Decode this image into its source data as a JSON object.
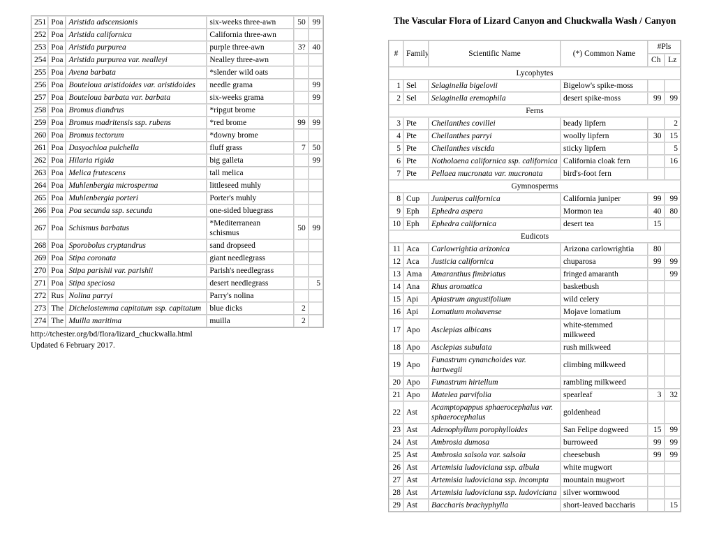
{
  "document": {
    "title": "The Vascular Flora of Lizard Canyon and Chuckwalla Wash / Canyon",
    "source_url": "http://tchester.org/bd/flora/lizard_chuckwalla.html",
    "updated": "Updated 6 February 2017."
  },
  "table_header": {
    "num": "#",
    "family": "Family",
    "scientific_name": "Scientific Name",
    "common_name": "(*) Common Name",
    "plants_group": "#Pls",
    "ch": "Ch",
    "lz": "Lz"
  },
  "left_table": {
    "rows": [
      {
        "num": "251",
        "family": "Poa",
        "sci": "Aristida adscensionis",
        "com": "six-weeks three-awn",
        "ch": "50",
        "lz": "99"
      },
      {
        "num": "252",
        "family": "Poa",
        "sci": "Aristida californica",
        "com": "California three-awn",
        "ch": "",
        "lz": ""
      },
      {
        "num": "253",
        "family": "Poa",
        "sci": "Aristida purpurea",
        "com": "purple three-awn",
        "ch": "3?",
        "lz": "40"
      },
      {
        "num": "254",
        "family": "Poa",
        "sci": "Aristida purpurea var. nealleyi",
        "com": "Nealley three-awn",
        "ch": "",
        "lz": ""
      },
      {
        "num": "255",
        "family": "Poa",
        "sci": "Avena barbata",
        "com": "*slender wild oats",
        "ch": "",
        "lz": ""
      },
      {
        "num": "256",
        "family": "Poa",
        "sci": "Bouteloua aristidoides var. aristidoides",
        "com": "needle grama",
        "ch": "",
        "lz": "99"
      },
      {
        "num": "257",
        "family": "Poa",
        "sci": "Bouteloua barbata var. barbata",
        "com": "six-weeks grama",
        "ch": "",
        "lz": "99"
      },
      {
        "num": "258",
        "family": "Poa",
        "sci": "Bromus diandrus",
        "com": "*ripgut brome",
        "ch": "",
        "lz": ""
      },
      {
        "num": "259",
        "family": "Poa",
        "sci": "Bromus madritensis ssp. rubens",
        "com": "*red brome",
        "ch": "99",
        "lz": "99"
      },
      {
        "num": "260",
        "family": "Poa",
        "sci": "Bromus tectorum",
        "com": "*downy brome",
        "ch": "",
        "lz": ""
      },
      {
        "num": "261",
        "family": "Poa",
        "sci": "Dasyochloa pulchella",
        "com": "fluff grass",
        "ch": "7",
        "lz": "50"
      },
      {
        "num": "262",
        "family": "Poa",
        "sci": "Hilaria rigida",
        "com": "big galleta",
        "ch": "",
        "lz": "99"
      },
      {
        "num": "263",
        "family": "Poa",
        "sci": "Melica frutescens",
        "com": "tall melica",
        "ch": "",
        "lz": ""
      },
      {
        "num": "264",
        "family": "Poa",
        "sci": "Muhlenbergia microsperma",
        "com": "littleseed muhly",
        "ch": "",
        "lz": ""
      },
      {
        "num": "265",
        "family": "Poa",
        "sci": "Muhlenbergia porteri",
        "com": "Porter's muhly",
        "ch": "",
        "lz": ""
      },
      {
        "num": "266",
        "family": "Poa",
        "sci": "Poa secunda ssp. secunda",
        "com": "one-sided bluegrass",
        "ch": "",
        "lz": ""
      },
      {
        "num": "267",
        "family": "Poa",
        "sci": "Schismus barbatus",
        "com": "*Mediterranean schismus",
        "ch": "50",
        "lz": "99"
      },
      {
        "num": "268",
        "family": "Poa",
        "sci": "Sporobolus cryptandrus",
        "com": "sand dropseed",
        "ch": "",
        "lz": ""
      },
      {
        "num": "269",
        "family": "Poa",
        "sci": "Stipa coronata",
        "com": "giant needlegrass",
        "ch": "",
        "lz": ""
      },
      {
        "num": "270",
        "family": "Poa",
        "sci": "Stipa parishii var. parishii",
        "com": "Parish's needlegrass",
        "ch": "",
        "lz": ""
      },
      {
        "num": "271",
        "family": "Poa",
        "sci": "Stipa speciosa",
        "com": "desert needlegrass",
        "ch": "",
        "lz": "5"
      },
      {
        "num": "272",
        "family": "Rus",
        "sci": "Nolina parryi",
        "com": "Parry's nolina",
        "ch": "",
        "lz": ""
      },
      {
        "num": "273",
        "family": "The",
        "sci": "Dichelostemma capitatum ssp. capitatum",
        "com": "blue dicks",
        "ch": "2",
        "lz": ""
      },
      {
        "num": "274",
        "family": "The",
        "sci": "Muilla maritima",
        "com": "muilla",
        "ch": "2",
        "lz": ""
      }
    ]
  },
  "right_table": {
    "blocks": [
      {
        "group": "Lycophytes",
        "rows": [
          {
            "num": "1",
            "family": "Sel",
            "sci": "Selaginella bigelovii",
            "com": "Bigelow's spike-moss",
            "ch": "",
            "lz": ""
          },
          {
            "num": "2",
            "family": "Sel",
            "sci": "Selaginella eremophila",
            "com": "desert spike-moss",
            "ch": "99",
            "lz": "99"
          }
        ]
      },
      {
        "group": "Ferns",
        "rows": [
          {
            "num": "3",
            "family": "Pte",
            "sci": "Cheilanthes covillei",
            "com": "beady lipfern",
            "ch": "",
            "lz": "2"
          },
          {
            "num": "4",
            "family": "Pte",
            "sci": "Cheilanthes parryi",
            "com": "woolly lipfern",
            "ch": "30",
            "lz": "15"
          },
          {
            "num": "5",
            "family": "Pte",
            "sci": "Cheilanthes viscida",
            "com": "sticky lipfern",
            "ch": "",
            "lz": "5"
          },
          {
            "num": "6",
            "family": "Pte",
            "sci": "Notholaena californica ssp. californica",
            "com": "California cloak fern",
            "ch": "",
            "lz": "16"
          },
          {
            "num": "7",
            "family": "Pte",
            "sci": "Pellaea mucronata var. mucronata",
            "com": "bird's-foot fern",
            "ch": "",
            "lz": ""
          }
        ]
      },
      {
        "group": "Gymnosperms",
        "rows": [
          {
            "num": "8",
            "family": "Cup",
            "sci": "Juniperus californica",
            "com": "California juniper",
            "ch": "99",
            "lz": "99"
          },
          {
            "num": "9",
            "family": "Eph",
            "sci": "Ephedra aspera",
            "com": "Mormon tea",
            "ch": "40",
            "lz": "80"
          },
          {
            "num": "10",
            "family": "Eph",
            "sci": "Ephedra californica",
            "com": "desert tea",
            "ch": "15",
            "lz": ""
          }
        ]
      },
      {
        "group": "Eudicots",
        "rows": [
          {
            "num": "11",
            "family": "Aca",
            "sci": "Carlowrightia arizonica",
            "com": "Arizona carlowrightia",
            "ch": "80",
            "lz": ""
          },
          {
            "num": "12",
            "family": "Aca",
            "sci": "Justicia californica",
            "com": "chuparosa",
            "ch": "99",
            "lz": "99"
          },
          {
            "num": "13",
            "family": "Ama",
            "sci": "Amaranthus fimbriatus",
            "com": "fringed amaranth",
            "ch": "",
            "lz": "99"
          },
          {
            "num": "14",
            "family": "Ana",
            "sci": "Rhus aromatica",
            "com": "basketbush",
            "ch": "",
            "lz": ""
          },
          {
            "num": "15",
            "family": "Api",
            "sci": "Apiastrum angustifolium",
            "com": "wild celery",
            "ch": "",
            "lz": ""
          },
          {
            "num": "16",
            "family": "Api",
            "sci": "Lomatium mohavense",
            "com": "Mojave lomatium",
            "ch": "",
            "lz": ""
          },
          {
            "num": "17",
            "family": "Apo",
            "sci": "Asclepias albicans",
            "com": "white-stemmed milkweed",
            "ch": "",
            "lz": ""
          },
          {
            "num": "18",
            "family": "Apo",
            "sci": "Asclepias subulata",
            "com": "rush milkweed",
            "ch": "",
            "lz": ""
          },
          {
            "num": "19",
            "family": "Apo",
            "sci": "Funastrum cynanchoides var. hartwegii",
            "com": "climbing milkweed",
            "ch": "",
            "lz": ""
          },
          {
            "num": "20",
            "family": "Apo",
            "sci": "Funastrum hirtellum",
            "com": "rambling milkweed",
            "ch": "",
            "lz": ""
          },
          {
            "num": "21",
            "family": "Apo",
            "sci": "Matelea parvifolia",
            "com": "spearleaf",
            "ch": "3",
            "lz": "32"
          },
          {
            "num": "22",
            "family": "Ast",
            "sci": "Acamptopappus sphaerocephalus var. sphaerocephalus",
            "com": "goldenhead",
            "ch": "",
            "lz": "",
            "tall": true
          },
          {
            "num": "23",
            "family": "Ast",
            "sci": "Adenophyllum porophylloides",
            "com": "San Felipe dogweed",
            "ch": "15",
            "lz": "99"
          },
          {
            "num": "24",
            "family": "Ast",
            "sci": "Ambrosia dumosa",
            "com": "burroweed",
            "ch": "99",
            "lz": "99"
          },
          {
            "num": "25",
            "family": "Ast",
            "sci": "Ambrosia salsola var. salsola",
            "com": "cheesebush",
            "ch": "99",
            "lz": "99"
          },
          {
            "num": "26",
            "family": "Ast",
            "sci": "Artemisia ludoviciana ssp. albula",
            "com": "white mugwort",
            "ch": "",
            "lz": ""
          },
          {
            "num": "27",
            "family": "Ast",
            "sci": "Artemisia ludoviciana ssp. incompta",
            "com": "mountain mugwort",
            "ch": "",
            "lz": ""
          },
          {
            "num": "28",
            "family": "Ast",
            "sci": "Artemisia ludoviciana ssp. ludoviciana",
            "com": "silver wormwood",
            "ch": "",
            "lz": ""
          },
          {
            "num": "29",
            "family": "Ast",
            "sci": "Baccharis brachyphylla",
            "com": "short-leaved baccharis",
            "ch": "",
            "lz": "15"
          }
        ]
      }
    ]
  }
}
